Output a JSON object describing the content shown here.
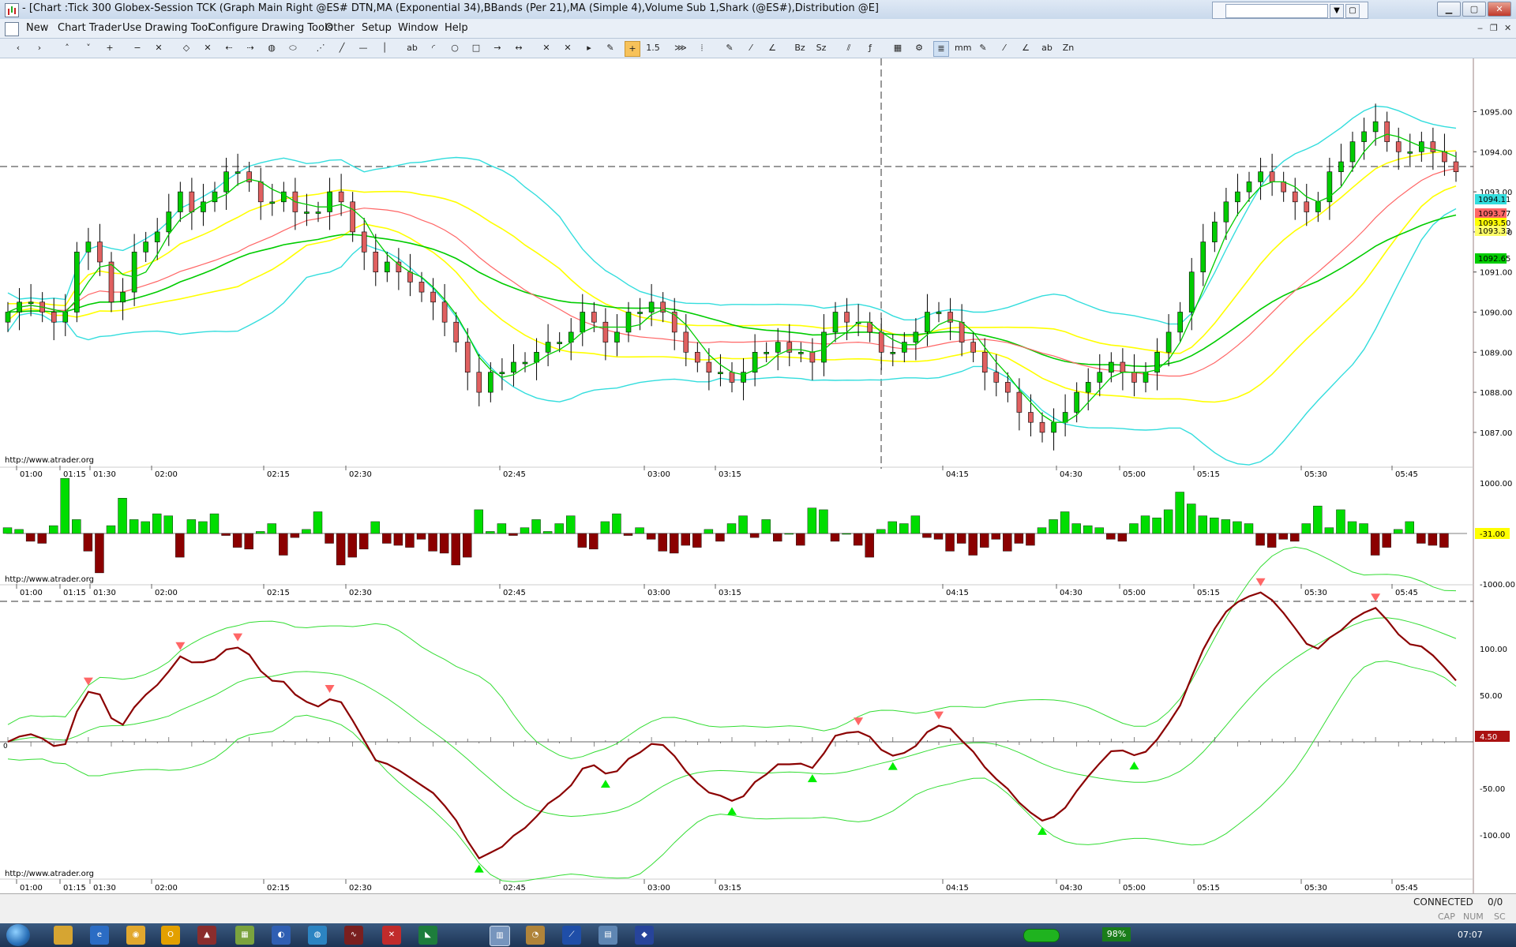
{
  "window": {
    "title": "- [Chart :Tick  300 Globex-Session TCK (Graph Main Right @ES# DTN,MA (Exponential 34),BBands (Per 21),MA (Simple 4),Volume Sub 1,Shark (@ES#),Distribution @E]"
  },
  "menu": {
    "items": [
      "New",
      "Chart Trader",
      "Use Drawing Tool",
      "Configure Drawing Tools",
      "Other",
      "Setup",
      "Window",
      "Help"
    ]
  },
  "toolbar": {
    "tools": [
      "‹",
      "›",
      "˄",
      "˅",
      "+",
      "−",
      "✕",
      "◇",
      "✕",
      "⇠",
      "⇢",
      "◍",
      "⬭",
      "⋰",
      "╱",
      "—",
      "│",
      "ab",
      "◜",
      "○",
      "□",
      "→",
      "↔",
      "✕",
      "✕",
      "▸",
      "✎",
      "+",
      "1.5",
      "⋙",
      "⦙",
      "✎",
      "⁄",
      "∠",
      "Bz",
      "Sz",
      "⫽",
      "ƒ",
      "▦",
      "⚙",
      "≣",
      "mm",
      "✎",
      "⁄",
      "∠",
      "ab",
      "Zn"
    ]
  },
  "chart_data": [
    {
      "type": "candlestick",
      "panel": "main",
      "yticks": [
        "1095.00",
        "1094.00",
        "1093.00",
        "1092.00",
        "1091.00",
        "1090.00",
        "1089.00",
        "1088.00",
        "1087.00"
      ],
      "ylim": [
        1086.25,
        1096.25
      ],
      "xticks": [
        "01:00",
        "01:15",
        "01:30",
        "02:00",
        "02:15",
        "02:30",
        "02:45",
        "03:00",
        "03:15",
        "04:15",
        "04:30",
        "05:00",
        "05:15",
        "05:30",
        "05:45"
      ],
      "closes": [
        1090.0,
        1090.25,
        1090.25,
        1090.0,
        1089.75,
        1090.0,
        1091.5,
        1091.75,
        1091.25,
        1090.25,
        1090.5,
        1091.5,
        1091.75,
        1092.0,
        1092.5,
        1093.0,
        1092.5,
        1092.75,
        1093.0,
        1093.5,
        1093.5,
        1093.25,
        1092.75,
        1092.75,
        1093.0,
        1092.5,
        1092.5,
        1092.5,
        1093.0,
        1092.75,
        1092.0,
        1091.5,
        1091.0,
        1091.25,
        1091.0,
        1090.75,
        1090.5,
        1090.25,
        1089.75,
        1089.25,
        1088.5,
        1088.0,
        1088.5,
        1088.5,
        1088.75,
        1088.75,
        1089.0,
        1089.25,
        1089.25,
        1089.5,
        1090.0,
        1089.75,
        1089.25,
        1089.5,
        1090.0,
        1090.0,
        1090.25,
        1090.0,
        1089.5,
        1089.0,
        1088.75,
        1088.5,
        1088.5,
        1088.25,
        1088.5,
        1089.0,
        1089.0,
        1089.25,
        1089.0,
        1089.0,
        1088.75,
        1089.5,
        1090.0,
        1089.75,
        1089.75,
        1089.5,
        1089.0,
        1089.0,
        1089.25,
        1089.5,
        1090.0,
        1090.0,
        1089.75,
        1089.25,
        1089.0,
        1088.5,
        1088.25,
        1088.0,
        1087.5,
        1087.25,
        1087.0,
        1087.25,
        1087.5,
        1088.0,
        1088.25,
        1088.5,
        1088.75,
        1088.5,
        1088.25,
        1088.5,
        1089.0,
        1089.5,
        1090.0,
        1091.0,
        1091.75,
        1092.25,
        1092.75,
        1093.0,
        1093.25,
        1093.5,
        1093.25,
        1093.0,
        1092.75,
        1092.5,
        1092.75,
        1093.5,
        1093.75,
        1094.25,
        1094.5,
        1094.75,
        1094.25,
        1094.0,
        1094.0,
        1094.25,
        1094.0,
        1093.75,
        1093.5
      ],
      "price_labels": [
        {
          "text": "1094.11",
          "color": "#33dddd"
        },
        {
          "text": "1093.77",
          "color": "#ff6666"
        },
        {
          "text": "1093.50",
          "color": "#ffff00"
        },
        {
          "text": "1093.33",
          "color": "#ffff66"
        },
        {
          "text": "1092.65",
          "color": "#00cc00"
        }
      ],
      "annotation": "http://www.atrader.org"
    },
    {
      "type": "bar",
      "panel": "volume-distribution",
      "yticks": [
        "1000.00",
        "-1000.00"
      ],
      "ylim": [
        -1800,
        1800
      ],
      "current_value": "-31.00",
      "annotation": "http://www.atrader.org"
    },
    {
      "type": "line",
      "panel": "shark-oscillator",
      "yticks": [
        "100.00",
        "50.00",
        "-50.00",
        "-100.00"
      ],
      "ylim": [
        -125,
        150
      ],
      "zero_label": "0",
      "current_value": "4.50",
      "annotation": "http://www.atrader.org"
    }
  ],
  "status": {
    "connection": "CONNECTED",
    "ratio": "0/0",
    "keys": [
      "CAP",
      "NUM",
      "SC"
    ]
  },
  "taskbar": {
    "battery": "98%",
    "clock": "07:07"
  },
  "colors": {
    "up_candle": "#00cc00",
    "down_candle": "#e06060",
    "ema": "#ff6666",
    "bband_outer": "#33dddd",
    "bband_inner": "#ffff00",
    "sma": "#00cc00",
    "vol_up": "#00dd00",
    "vol_down": "#8b0000",
    "oscillator": "#8b0000",
    "oscillator_bands": "#33dd33"
  }
}
